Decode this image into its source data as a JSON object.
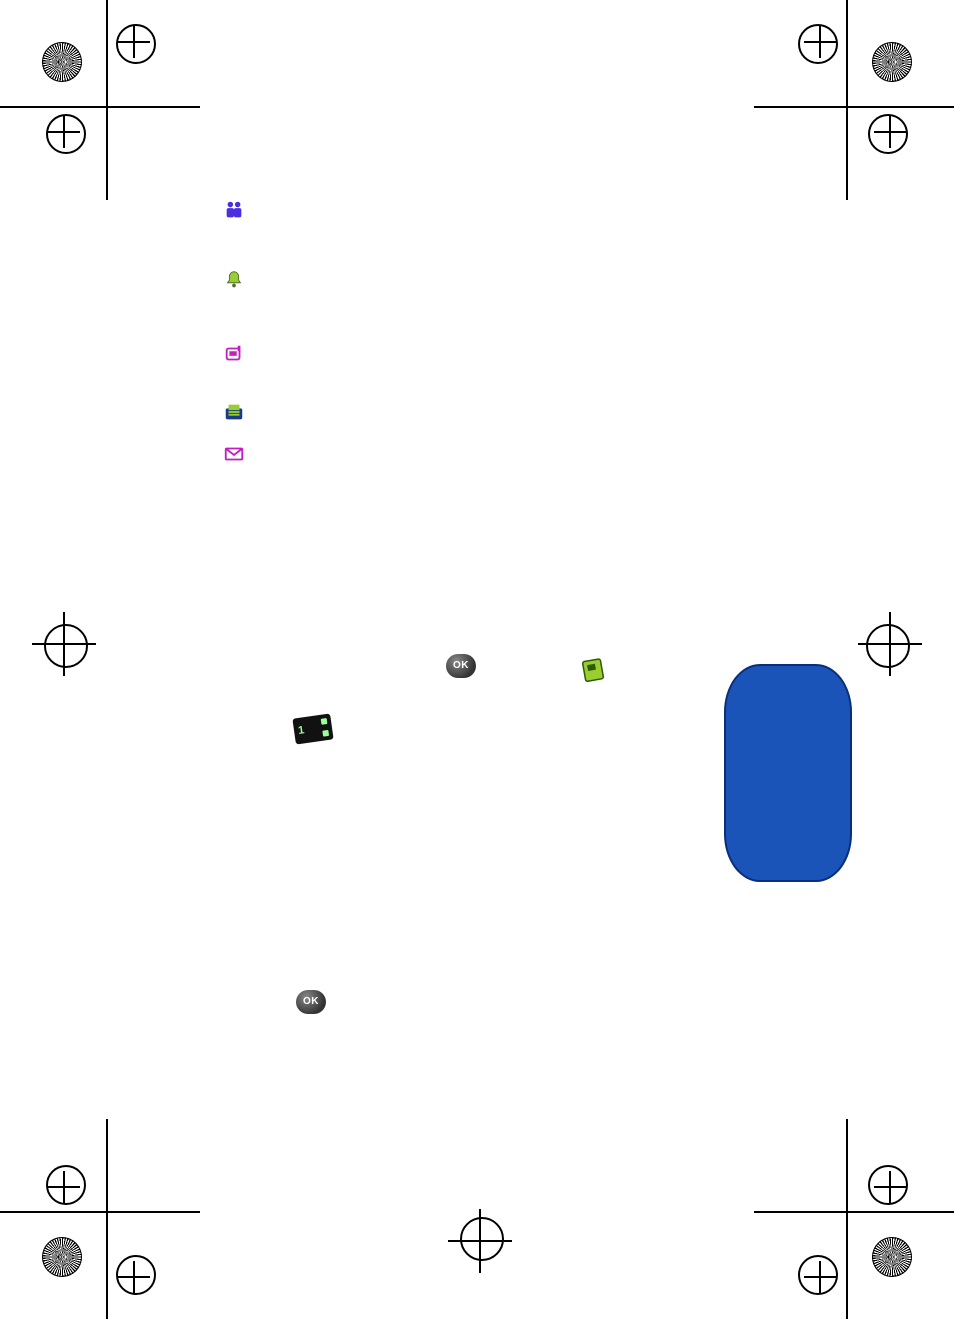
{
  "icons": {
    "people": "people-icon",
    "bell": "bell-icon",
    "pager": "pager-icon",
    "fax": "fax-icon",
    "mail": "mail-icon"
  },
  "buttons": {
    "ok1": "OK",
    "ok2": "OK",
    "card": "1"
  }
}
